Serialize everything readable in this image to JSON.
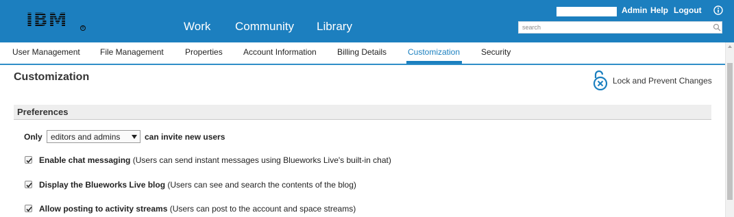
{
  "header": {
    "logo": "IBM",
    "nav": [
      "Work",
      "Community",
      "Library"
    ],
    "links": {
      "admin": "Admin",
      "help": "Help",
      "logout": "Logout"
    },
    "search_placeholder": "search",
    "bg_color": "#1c7fbf"
  },
  "tabs": {
    "items": [
      "User Management",
      "File Management",
      "Properties",
      "Account Information",
      "Billing Details",
      "Customization",
      "Security"
    ],
    "active": "Customization"
  },
  "page": {
    "title": "Customization",
    "lock_label": "Lock and Prevent Changes"
  },
  "preferences": {
    "title": "Preferences",
    "invite": {
      "prefix": "Only",
      "selected": "editors and admins",
      "suffix": "can invite new users"
    },
    "options": [
      {
        "label": "Enable chat messaging",
        "desc": "(Users can send instant messages using Blueworks Live's built-in chat)",
        "checked": true
      },
      {
        "label": "Display the Blueworks Live blog",
        "desc": "(Users can see and search the contents of the blog)",
        "checked": true
      },
      {
        "label": "Allow posting to activity streams",
        "desc": "(Users can post to the account and space streams)",
        "checked": true
      }
    ]
  },
  "colors": {
    "accent": "#1a7fbf",
    "section_bg": "#eeeeee"
  }
}
